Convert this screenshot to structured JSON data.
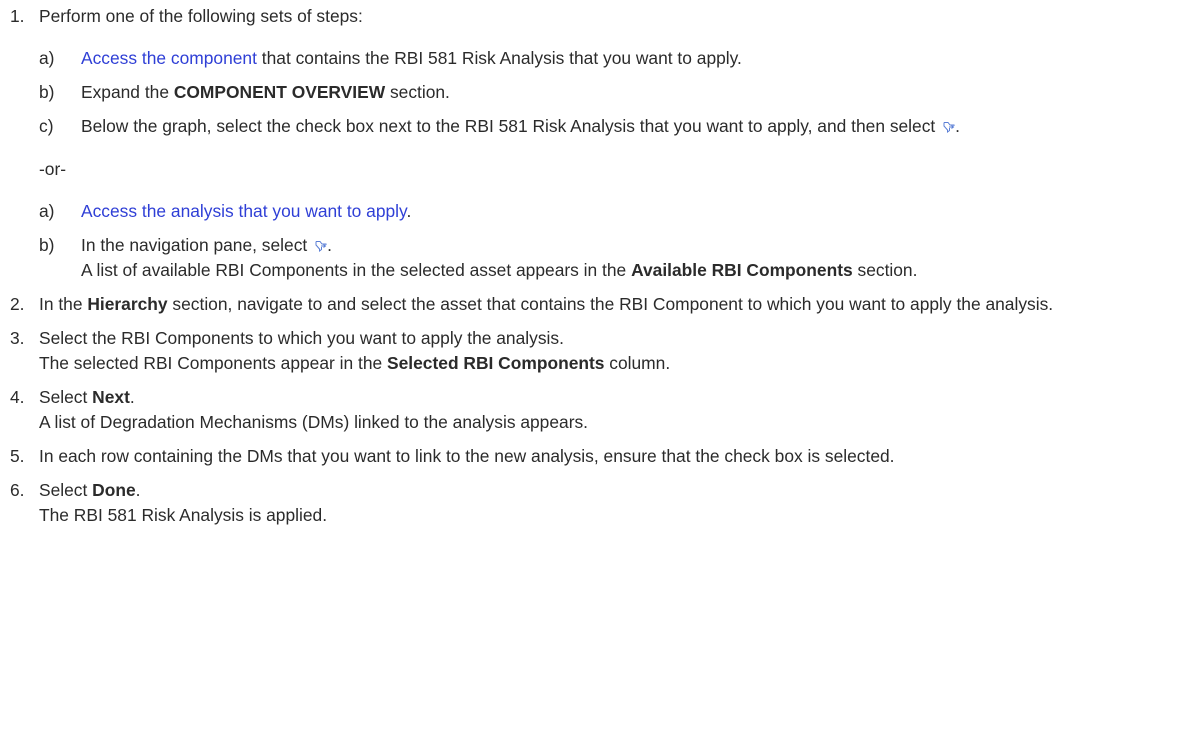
{
  "steps": [
    {
      "num": "1.",
      "text": "Perform one of the following sets of steps:",
      "set_a": [
        {
          "letter": "a)",
          "link": "Access the component",
          "rest": " that contains the RBI 581 Risk Analysis that you want to apply."
        },
        {
          "letter": "b)",
          "pre": "Expand the ",
          "bold": "COMPONENT OVERVIEW",
          "post": " section."
        },
        {
          "letter": "c)",
          "text": "Below the graph, select the check box next to the RBI 581 Risk Analysis that you want to apply, and then select",
          "post": "."
        }
      ],
      "or": "-or-",
      "set_b": [
        {
          "letter": "a)",
          "link": "Access the analysis that you want to apply",
          "post": "."
        },
        {
          "letter": "b)",
          "text": "In the navigation pane, select",
          "post": ".",
          "result_pre": "A list of available RBI Components in the selected asset appears in the ",
          "result_bold": "Available RBI Components",
          "result_post": " section."
        }
      ]
    },
    {
      "num": "2.",
      "pre": "In the ",
      "bold": "Hierarchy",
      "post": " section, navigate to and select the asset that contains the RBI Component to which you want to apply the analysis."
    },
    {
      "num": "3.",
      "text": "Select the RBI Components to which you want to apply the analysis.",
      "result_pre": "The selected RBI Components appear in the ",
      "result_bold": "Selected RBI Components",
      "result_post": " column."
    },
    {
      "num": "4.",
      "pre": "Select ",
      "bold": "Next",
      "post": ".",
      "result": "A list of Degradation Mechanisms (DMs) linked to the analysis appears."
    },
    {
      "num": "5.",
      "text": "In each row containing the DMs that you want to link to the new analysis, ensure that the check box is selected."
    },
    {
      "num": "6.",
      "pre": "Select ",
      "bold": "Done",
      "post": ".",
      "result": "The RBI 581 Risk Analysis is applied."
    }
  ],
  "icons": {
    "apply": "apply-analysis-icon",
    "color": "#5b7fd6"
  },
  "colors": {
    "text": "#2b2b2b",
    "link": "#2f3fd6"
  }
}
